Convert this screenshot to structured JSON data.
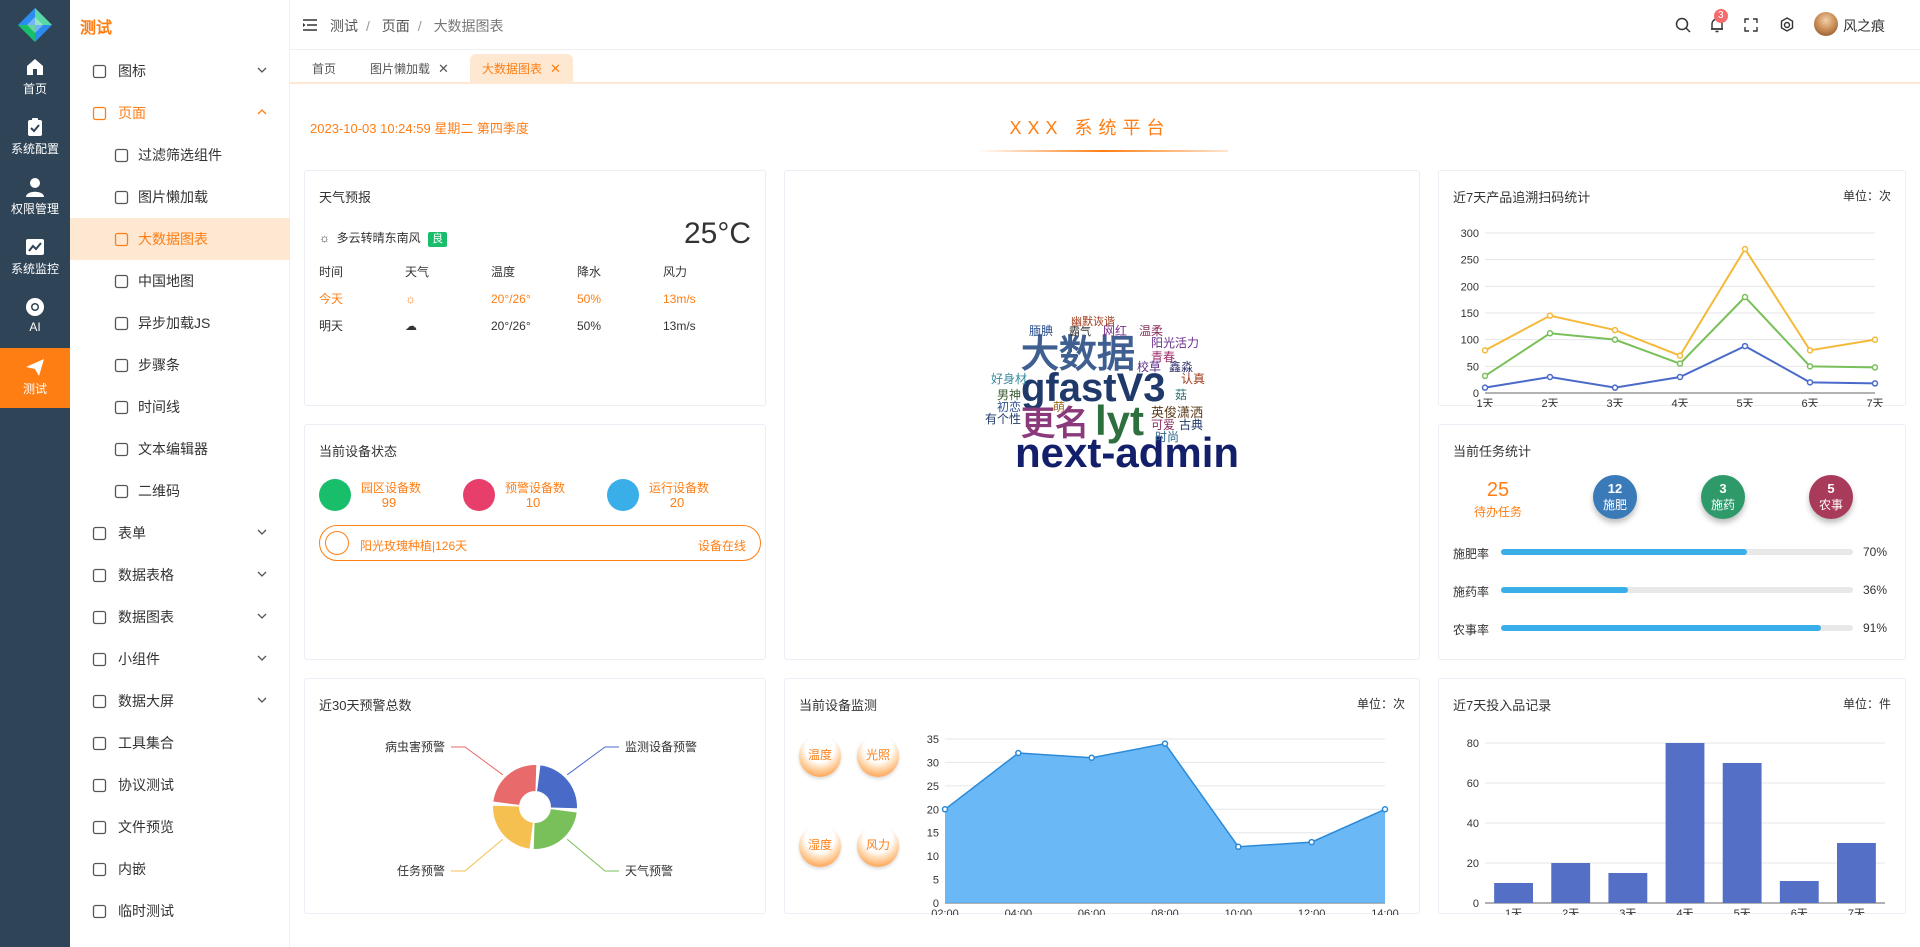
{
  "rail": [
    {
      "label": "首页",
      "icon": "home-icon"
    },
    {
      "label": "系统配置",
      "icon": "clipboard-icon"
    },
    {
      "label": "权限管理",
      "icon": "user-icon"
    },
    {
      "label": "系统监控",
      "icon": "monitor-chart-icon"
    },
    {
      "label": "AI",
      "icon": "chrome-icon"
    },
    {
      "label": "测试",
      "icon": "send-icon",
      "active": true
    }
  ],
  "menu": {
    "title": "测试",
    "items": [
      {
        "label": "图标",
        "icon": "grid-icon",
        "arrow": "down"
      },
      {
        "label": "页面",
        "icon": "window-icon",
        "arrow": "up",
        "open": true
      },
      {
        "label": "过滤筛选组件",
        "icon": "filter-icon",
        "sub": true
      },
      {
        "label": "图片懒加载",
        "icon": "refresh-icon",
        "sub": true
      },
      {
        "label": "大数据图表",
        "icon": "bar-chart-icon",
        "sub": true,
        "active": true
      },
      {
        "label": "中国地图",
        "icon": "map-icon",
        "sub": true
      },
      {
        "label": "异步加载JS",
        "icon": "location-icon",
        "sub": true
      },
      {
        "label": "步骤条",
        "icon": "sliders-icon",
        "sub": true
      },
      {
        "label": "时间线",
        "icon": "clock-icon",
        "sub": true
      },
      {
        "label": "文本编辑器",
        "icon": "edit-icon",
        "sub": true
      },
      {
        "label": "二维码",
        "icon": "qrcode-icon",
        "sub": true
      },
      {
        "label": "表单",
        "icon": "form-icon",
        "arrow": "down"
      },
      {
        "label": "数据表格",
        "icon": "table-icon",
        "arrow": "down"
      },
      {
        "label": "数据图表",
        "icon": "pie-icon",
        "arrow": "down"
      },
      {
        "label": "小组件",
        "icon": "widget-icon",
        "arrow": "down"
      },
      {
        "label": "数据大屏",
        "icon": "screen-icon",
        "arrow": "down"
      },
      {
        "label": "工具集合",
        "icon": "toolbox-icon"
      },
      {
        "label": "协议测试",
        "icon": "truck-icon"
      },
      {
        "label": "文件预览",
        "icon": "preview-icon"
      },
      {
        "label": "内嵌",
        "icon": "globe-icon"
      },
      {
        "label": "临时测试",
        "icon": "cube-icon"
      }
    ]
  },
  "header": {
    "breadcrumb": [
      "测试",
      "页面",
      "大数据图表"
    ],
    "notify_count": "3",
    "user": "风之痕"
  },
  "tabs": [
    {
      "label": "首页"
    },
    {
      "label": "图片懒加载",
      "closable": true
    },
    {
      "label": "大数据图表",
      "closable": true,
      "active": true
    }
  ],
  "page": {
    "datetime": "2023-10-03 10:24:59 星期二 第四季度",
    "title": "XXX 系统平台"
  },
  "weather": {
    "title": "天气预报",
    "desc": "多云转晴东南风",
    "quality": "良",
    "temp": "25°C",
    "columns": [
      "时间",
      "天气",
      "温度",
      "降水",
      "风力"
    ],
    "rows": [
      {
        "day": "今天",
        "icon": "sun-icon",
        "temp": "20°/26°",
        "rain": "50%",
        "wind": "13m/s"
      },
      {
        "day": "明天",
        "icon": "cloud-rain-icon",
        "temp": "20°/26°",
        "rain": "50%",
        "wind": "13m/s"
      }
    ]
  },
  "device_status": {
    "title": "当前设备状态",
    "items": [
      {
        "label": "园区设备数",
        "value": "99",
        "color": "#19be6b",
        "icon": "gauge-icon"
      },
      {
        "label": "预警设备数",
        "value": "10",
        "color": "#e83e6c",
        "icon": "alarm-icon"
      },
      {
        "label": "运行设备数",
        "value": "20",
        "color": "#3aaee8",
        "icon": "play-icon"
      }
    ],
    "bar_text": "阳光玫瑰种植|126天",
    "bar_status": "设备在线"
  },
  "wordcloud": [
    {
      "text": "next-admin",
      "color": "#141f6b"
    },
    {
      "text": "gfastV3",
      "color": "#1f3a6a"
    },
    {
      "text": "大数据",
      "color": "#3e5f8f"
    },
    {
      "text": "更名",
      "color": "#8a3a7a"
    },
    {
      "text": "lyt",
      "color": "#2e6f3e"
    },
    {
      "text": "幽默诙谐",
      "color": "#a03a1a"
    },
    {
      "text": "腼腆",
      "color": "#2e4f8f"
    },
    {
      "text": "霸气",
      "color": "#333333"
    },
    {
      "text": "网红",
      "color": "#7a2e8a"
    },
    {
      "text": "温柔",
      "color": "#8a2e5e"
    },
    {
      "text": "阳光活力",
      "color": "#6a2e8a"
    },
    {
      "text": "青春",
      "color": "#a02e6a"
    },
    {
      "text": "校草",
      "color": "#5e2e8a"
    },
    {
      "text": "鑫淼",
      "color": "#2e2e6a"
    },
    {
      "text": "认真",
      "color": "#a03a1a"
    },
    {
      "text": "好身材",
      "color": "#3a8aa0"
    },
    {
      "text": "男神",
      "color": "#3a5a2e"
    },
    {
      "text": "初恋",
      "color": "#2e4f8f"
    },
    {
      "text": "萌",
      "color": "#a06a1a"
    },
    {
      "text": "有个性",
      "color": "#1f3a6a"
    },
    {
      "text": "英俊潇洒",
      "color": "#5a3a1a"
    },
    {
      "text": "菇",
      "color": "#2e6f6f"
    },
    {
      "text": "可爱",
      "color": "#8a2e5e"
    },
    {
      "text": "古典",
      "color": "#1f3a6a"
    },
    {
      "text": "时尚",
      "color": "#2e6a8a"
    }
  ],
  "icons": {
    "hamburger": "menu-icon",
    "search": "search-icon",
    "bell": "bell-icon",
    "fullscreen": "fullscreen-icon",
    "settings": "gear-icon"
  },
  "tasks": {
    "title": "当前任务统计",
    "pending": "25",
    "pending_label": "待办任务",
    "balls": [
      {
        "value": "12",
        "label": "施肥",
        "color": "#3a7ab8"
      },
      {
        "value": "3",
        "label": "施药",
        "color": "#2e9a6a"
      },
      {
        "value": "5",
        "label": "农事",
        "color": "#a83a5a"
      }
    ],
    "progress": [
      {
        "label": "施肥率",
        "pct": 70,
        "text": "70%"
      },
      {
        "label": "施药率",
        "pct": 36,
        "text": "36%"
      },
      {
        "label": "农事率",
        "pct": 91,
        "text": "91%"
      }
    ]
  },
  "alerts": {
    "title": "近30天预警总数"
  },
  "monitor": {
    "title": "当前设备监测",
    "unit": "单位：次",
    "balls": [
      "温度",
      "光照",
      "湿度",
      "风力"
    ]
  },
  "chart_data": [
    {
      "type": "line",
      "title": "近7天产品追溯扫码统计",
      "unit": "单位：次",
      "categories": [
        "1天",
        "2天",
        "3天",
        "4天",
        "5天",
        "6天",
        "7天"
      ],
      "ylim": [
        0,
        300
      ],
      "yticks": [
        0,
        50,
        100,
        150,
        200,
        250,
        300
      ],
      "grid": true,
      "colors": [
        "#f5b93a",
        "#7ac05a",
        "#4a6ac8"
      ],
      "series": [
        {
          "values": [
            80,
            145,
            118,
            70,
            270,
            80,
            100
          ]
        },
        {
          "values": [
            32,
            112,
            100,
            55,
            180,
            50,
            48
          ]
        },
        {
          "values": [
            10,
            30,
            10,
            30,
            88,
            20,
            18
          ]
        }
      ]
    },
    {
      "type": "pie",
      "labels": [
        "监测设备预警",
        "天气预警",
        "任务预警",
        "病虫害预警"
      ],
      "values": [
        1,
        1,
        1,
        1
      ],
      "colors": [
        "#4a6ac8",
        "#7ac05a",
        "#f5c050",
        "#e86a6a"
      ]
    },
    {
      "type": "area",
      "categories": [
        "02:00",
        "04:00",
        "06:00",
        "08:00",
        "10:00",
        "12:00",
        "14:00"
      ],
      "values": [
        20,
        32,
        31,
        34,
        12,
        13,
        20
      ],
      "ylim": [
        0,
        35
      ],
      "yticks": [
        0,
        5,
        10,
        15,
        20,
        25,
        30,
        35
      ],
      "grid": true,
      "color": "#5ab0f5"
    },
    {
      "type": "bar",
      "title": "近7天投入品记录",
      "unit": "单位：件",
      "categories": [
        "1天",
        "2天",
        "3天",
        "4天",
        "5天",
        "6天",
        "7天"
      ],
      "values": [
        10,
        20,
        15,
        80,
        70,
        11,
        30
      ],
      "ylim": [
        0,
        80
      ],
      "yticks": [
        0,
        20,
        40,
        60,
        80
      ],
      "grid": true,
      "color": "#5470c6"
    }
  ]
}
